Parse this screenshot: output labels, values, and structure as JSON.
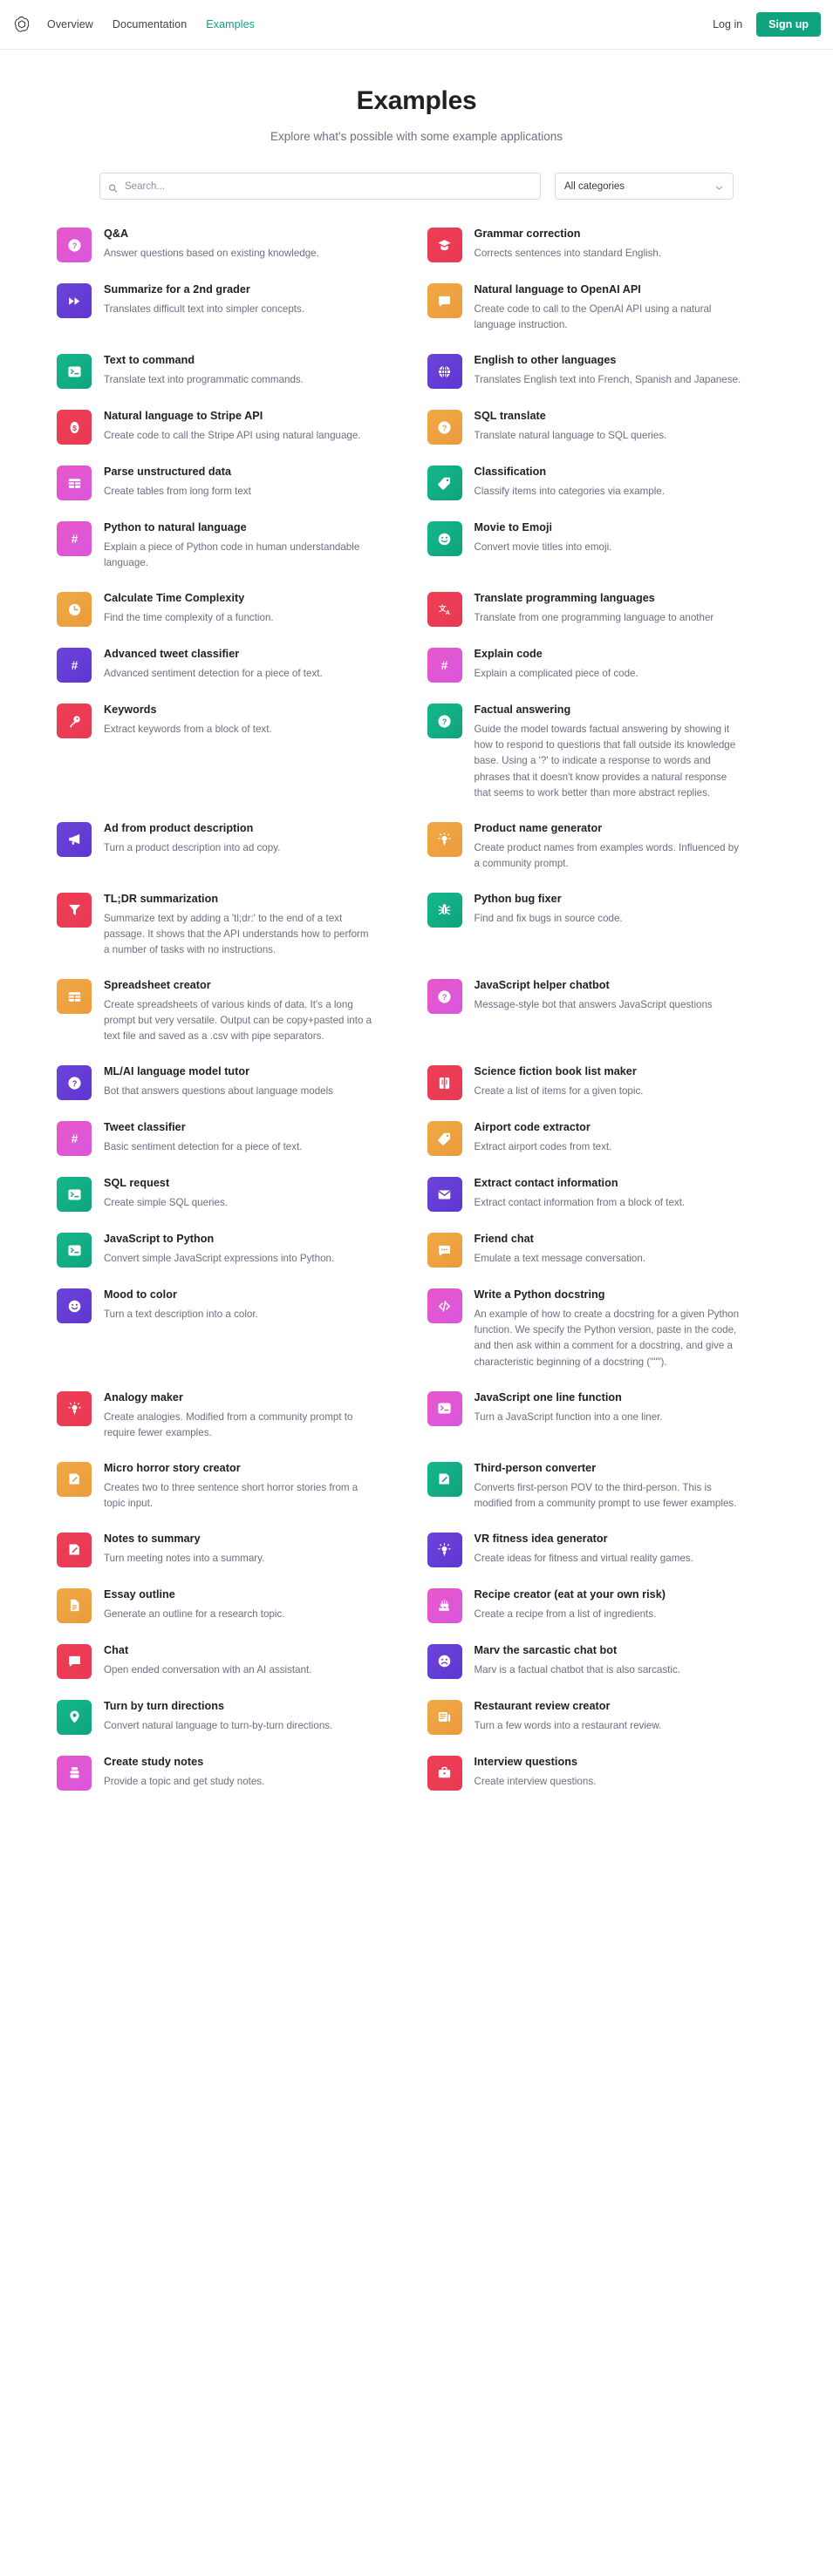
{
  "nav": {
    "logo_icon": "openai-logo-icon",
    "links": [
      {
        "label": "Overview",
        "active": false
      },
      {
        "label": "Documentation",
        "active": false
      },
      {
        "label": "Examples",
        "active": true
      }
    ],
    "login_label": "Log in",
    "signup_label": "Sign up",
    "accent_color": "#10a37f"
  },
  "hero": {
    "title": "Examples",
    "subtitle": "Explore what's possible with some example applications"
  },
  "filters": {
    "search_placeholder": "Search...",
    "search_value": "",
    "search_icon": "search-icon",
    "category_value": "All categories",
    "category_icon": "chevron-down-icon"
  },
  "colors": {
    "pink": "#dd5ce5",
    "pink2": "#e255a1",
    "magenta": "#e059ce",
    "purple": "#6b40d8",
    "violet": "#7048e8",
    "green": "#10a37f",
    "orange": "#eda345",
    "red": "#ef4146",
    "crimson": "#e9495f"
  },
  "cards_left": [
    {
      "title": "Q&A",
      "desc": "Answer questions based on existing knowledge.",
      "icon": "question-mark-icon",
      "c1": "#e858c8",
      "c2": "#d956df"
    },
    {
      "title": "Summarize for a 2nd grader",
      "desc": "Translates difficult text into simpler concepts.",
      "icon": "fast-forward-icon",
      "c1": "#6e44d9",
      "c2": "#5d35d1"
    },
    {
      "title": "Text to command",
      "desc": "Translate text into programmatic commands.",
      "icon": "terminal-icon",
      "c1": "#14b88a",
      "c2": "#10a37f"
    },
    {
      "title": "Natural language to Stripe API",
      "desc": "Create code to call the Stripe API using natural language.",
      "icon": "dollar-coin-icon",
      "c1": "#ef3e56",
      "c2": "#e73a52"
    },
    {
      "title": "Parse unstructured data",
      "desc": "Create tables from long form text",
      "icon": "table-icon",
      "c1": "#e858c8",
      "c2": "#d956df"
    },
    {
      "title": "Python to natural language",
      "desc": "Explain a piece of Python code in human understandable language.",
      "icon": "hash-icon",
      "c1": "#e858c8",
      "c2": "#d956df"
    },
    {
      "title": "Calculate Time Complexity",
      "desc": "Find the time complexity of a function.",
      "icon": "clock-icon",
      "c1": "#f0a945",
      "c2": "#eb9b3c"
    },
    {
      "title": "Advanced tweet classifier",
      "desc": "Advanced sentiment detection for a piece of text.",
      "icon": "hash-icon",
      "c1": "#6e44d9",
      "c2": "#5d35d1"
    },
    {
      "title": "Keywords",
      "desc": "Extract keywords from a block of text.",
      "icon": "key-icon",
      "c1": "#ef3e56",
      "c2": "#e73a52"
    },
    {
      "title": "Ad from product description",
      "desc": "Turn a product description into ad copy.",
      "icon": "megaphone-icon",
      "c1": "#6e44d9",
      "c2": "#5d35d1"
    },
    {
      "title": "TL;DR summarization",
      "desc": "Summarize text by adding a 'tl;dr:' to the end of a text passage. It shows that the API understands how to perform a number of tasks with no instructions.",
      "icon": "funnel-icon",
      "c1": "#ef3e56",
      "c2": "#e73a52"
    },
    {
      "title": "Spreadsheet creator",
      "desc": "Create spreadsheets of various kinds of data. It's a long prompt but very versatile. Output can be copy+pasted into a text file and saved as a .csv with pipe separators.",
      "icon": "table-icon",
      "c1": "#f0a945",
      "c2": "#eb9b3c"
    },
    {
      "title": "ML/AI language model tutor",
      "desc": "Bot that answers questions about language models",
      "icon": "question-mark-icon",
      "c1": "#6e44d9",
      "c2": "#5d35d1"
    },
    {
      "title": "Tweet classifier",
      "desc": "Basic sentiment detection for a piece of text.",
      "icon": "hash-icon",
      "c1": "#e858c8",
      "c2": "#d956df"
    },
    {
      "title": "SQL request",
      "desc": "Create simple SQL queries.",
      "icon": "terminal-icon",
      "c1": "#14b88a",
      "c2": "#10a37f"
    },
    {
      "title": "JavaScript to Python",
      "desc": "Convert simple JavaScript expressions into Python.",
      "icon": "terminal-icon",
      "c1": "#14b88a",
      "c2": "#10a37f"
    },
    {
      "title": "Mood to color",
      "desc": "Turn a text description into a color.",
      "icon": "smiley-icon",
      "c1": "#6e44d9",
      "c2": "#5d35d1"
    },
    {
      "title": "Analogy maker",
      "desc": "Create analogies. Modified from a community prompt to require fewer examples.",
      "icon": "lightbulb-icon",
      "c1": "#ef3e56",
      "c2": "#e73a52"
    },
    {
      "title": "Micro horror story creator",
      "desc": "Creates two to three sentence short horror stories from a topic input.",
      "icon": "pencil-square-icon",
      "c1": "#f0a945",
      "c2": "#eb9b3c"
    },
    {
      "title": "Notes to summary",
      "desc": "Turn meeting notes into a summary.",
      "icon": "pencil-square-icon",
      "c1": "#ef3e56",
      "c2": "#e73a52"
    },
    {
      "title": "Essay outline",
      "desc": "Generate an outline for a research topic.",
      "icon": "document-icon",
      "c1": "#f0a945",
      "c2": "#eb9b3c"
    },
    {
      "title": "Chat",
      "desc": "Open ended conversation with an AI assistant.",
      "icon": "chat-bubble-icon",
      "c1": "#ef3e56",
      "c2": "#e73a52"
    },
    {
      "title": "Turn by turn directions",
      "desc": "Convert natural language to turn-by-turn directions.",
      "icon": "map-pin-icon",
      "c1": "#14b88a",
      "c2": "#10a37f"
    },
    {
      "title": "Create study notes",
      "desc": "Provide a topic and get study notes.",
      "icon": "book-stack-icon",
      "c1": "#e858c8",
      "c2": "#d956df"
    }
  ],
  "cards_right": [
    {
      "title": "Grammar correction",
      "desc": "Corrects sentences into standard English.",
      "icon": "graduation-cap-icon",
      "c1": "#ef3e56",
      "c2": "#e73a52"
    },
    {
      "title": "Natural language to OpenAI API",
      "desc": "Create code to call to the OpenAI API using a natural language instruction.",
      "icon": "chat-bubble-icon",
      "c1": "#f0a945",
      "c2": "#eb9b3c"
    },
    {
      "title": "English to other languages",
      "desc": "Translates English text into French, Spanish and Japanese.",
      "icon": "globe-icon",
      "c1": "#6e44d9",
      "c2": "#5d35d1"
    },
    {
      "title": "SQL translate",
      "desc": "Translate natural language to SQL queries.",
      "icon": "question-mark-icon",
      "c1": "#f0a945",
      "c2": "#eb9b3c"
    },
    {
      "title": "Classification",
      "desc": "Classify items into categories via example.",
      "icon": "tag-icon",
      "c1": "#14b88a",
      "c2": "#10a37f"
    },
    {
      "title": "Movie to Emoji",
      "desc": "Convert movie titles into emoji.",
      "icon": "smiley-icon",
      "c1": "#14b88a",
      "c2": "#10a37f"
    },
    {
      "title": "Translate programming languages",
      "desc": "Translate from one programming language to another",
      "icon": "translate-icon",
      "c1": "#ef3e56",
      "c2": "#e73a52"
    },
    {
      "title": "Explain code",
      "desc": "Explain a complicated piece of code.",
      "icon": "hash-icon",
      "c1": "#e858c8",
      "c2": "#d956df"
    },
    {
      "title": "Factual answering",
      "desc": "Guide the model towards factual answering by showing it how to respond to questions that fall outside its knowledge base. Using a '?' to indicate a response to words and phrases that it doesn't know provides a natural response that seems to work better than more abstract replies.",
      "icon": "question-mark-icon",
      "c1": "#14b88a",
      "c2": "#10a37f"
    },
    {
      "title": "Product name generator",
      "desc": "Create product names from examples words. Influenced by a community prompt.",
      "icon": "lightbulb-icon",
      "c1": "#f0a945",
      "c2": "#eb9b3c"
    },
    {
      "title": "Python bug fixer",
      "desc": "Find and fix bugs in source code.",
      "icon": "bug-icon",
      "c1": "#14b88a",
      "c2": "#10a37f"
    },
    {
      "title": "JavaScript helper chatbot",
      "desc": "Message-style bot that answers JavaScript questions",
      "icon": "question-mark-icon",
      "c1": "#e858c8",
      "c2": "#d956df"
    },
    {
      "title": "Science fiction book list maker",
      "desc": "Create a list of items for a given topic.",
      "icon": "book-icon",
      "c1": "#ef3e56",
      "c2": "#e73a52"
    },
    {
      "title": "Airport code extractor",
      "desc": "Extract airport codes from text.",
      "icon": "tag-icon",
      "c1": "#f0a945",
      "c2": "#eb9b3c"
    },
    {
      "title": "Extract contact information",
      "desc": "Extract contact information from a block of text.",
      "icon": "envelope-icon",
      "c1": "#6e44d9",
      "c2": "#5d35d1"
    },
    {
      "title": "Friend chat",
      "desc": "Emulate a text message conversation.",
      "icon": "chat-dots-icon",
      "c1": "#f0a945",
      "c2": "#eb9b3c"
    },
    {
      "title": "Write a Python docstring",
      "desc": "An example of how to create a docstring for a given Python function. We specify the Python version, paste in the code, and then ask within a comment for a docstring, and give a characteristic beginning of a docstring (\"\"\").",
      "icon": "code-brackets-icon",
      "c1": "#e858c8",
      "c2": "#d956df"
    },
    {
      "title": "JavaScript one line function",
      "desc": "Turn a JavaScript function into a one liner.",
      "icon": "terminal-icon",
      "c1": "#e858c8",
      "c2": "#d956df"
    },
    {
      "title": "Third-person converter",
      "desc": "Converts first-person POV to the third-person. This is modified from a community prompt to use fewer examples.",
      "icon": "pencil-square-icon",
      "c1": "#14b88a",
      "c2": "#10a37f"
    },
    {
      "title": "VR fitness idea generator",
      "desc": "Create ideas for fitness and virtual reality games.",
      "icon": "lightbulb-icon",
      "c1": "#6e44d9",
      "c2": "#5d35d1"
    },
    {
      "title": "Recipe creator (eat at your own risk)",
      "desc": "Create a recipe from a list of ingredients.",
      "icon": "cake-icon",
      "c1": "#e858c8",
      "c2": "#d956df"
    },
    {
      "title": "Marv the sarcastic chat bot",
      "desc": "Marv is a factual chatbot that is also sarcastic.",
      "icon": "sad-face-icon",
      "c1": "#6e44d9",
      "c2": "#5d35d1"
    },
    {
      "title": "Restaurant review creator",
      "desc": "Turn a few words into a restaurant review.",
      "icon": "news-icon",
      "c1": "#f0a945",
      "c2": "#eb9b3c"
    },
    {
      "title": "Interview questions",
      "desc": "Create interview questions.",
      "icon": "briefcase-icon",
      "c1": "#ef3e56",
      "c2": "#e73a52"
    }
  ]
}
